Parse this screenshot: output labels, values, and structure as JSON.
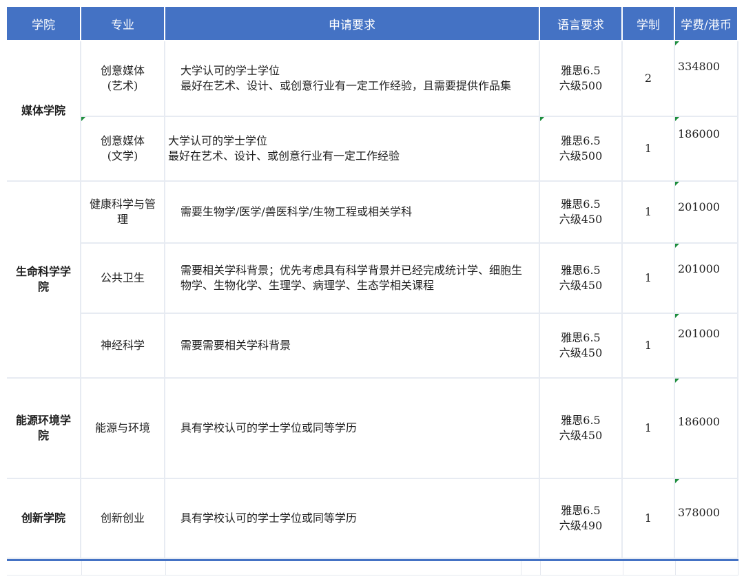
{
  "headers": {
    "college": "学院",
    "major": "专业",
    "requirement": "申请要求",
    "language": "语言要求",
    "duration": "学制",
    "fee": "学费/港币"
  },
  "colleges": {
    "media": "媒体学院",
    "life": "生命科学学院",
    "energy": "能源环境学院",
    "innovation": "创新学院"
  },
  "rows": [
    {
      "major_line1": "创意媒体",
      "major_line2": "(艺术)",
      "req_line1": "大学认可的学士学位",
      "req_line2": "最好在艺术、设计、或创意行业有一定工作经验，且需要提供作品集",
      "lang_line1": "雅思6.5",
      "lang_line2": "六级500",
      "duration": "2",
      "fee": "334800"
    },
    {
      "major_line1": "创意媒体",
      "major_line2": "(文学)",
      "req_line1": "大学认可的学士学位",
      "req_line2": "最好在艺术、设计、或创意行业有一定工作经验",
      "lang_line1": "雅思6.5",
      "lang_line2": "六级500",
      "duration": "1",
      "fee": "186000"
    },
    {
      "major_line1": "健康科学与管理",
      "req_line1": "需要生物学/医学/兽医科学/生物工程或相关学科",
      "lang_line1": "雅思6.5",
      "lang_line2": "六级450",
      "duration": "1",
      "fee": "201000"
    },
    {
      "major_line1": "公共卫生",
      "req_line1": "需要相关学科背景；优先考虑具有科学背景并已经完成统计学、细胞生物学、生物化学、生理学、病理学、生态学相关课程",
      "lang_line1": "雅思6.5",
      "lang_line2": "六级450",
      "duration": "1",
      "fee": "201000"
    },
    {
      "major_line1": "神经科学",
      "req_line1": "需要需要相关学科背景",
      "lang_line1": "雅思6.5",
      "lang_line2": "六级450",
      "duration": "1",
      "fee": "201000"
    },
    {
      "major_line1": "能源与环境",
      "req_line1": "具有学校认可的学士学位或同等学历",
      "lang_line1": "雅思6.5",
      "lang_line2": "六级450",
      "duration": "1",
      "fee": "186000"
    },
    {
      "major_line1": "创新创业",
      "req_line1": "具有学校认可的学士学位或同等学历",
      "lang_line1": "雅思6.5",
      "lang_line2": "六级490",
      "duration": "1",
      "fee": "378000"
    }
  ],
  "colors": {
    "header_bg": "#4472c4",
    "grid": "#e7ebf2",
    "cell_marker": "#1e8e3e"
  }
}
